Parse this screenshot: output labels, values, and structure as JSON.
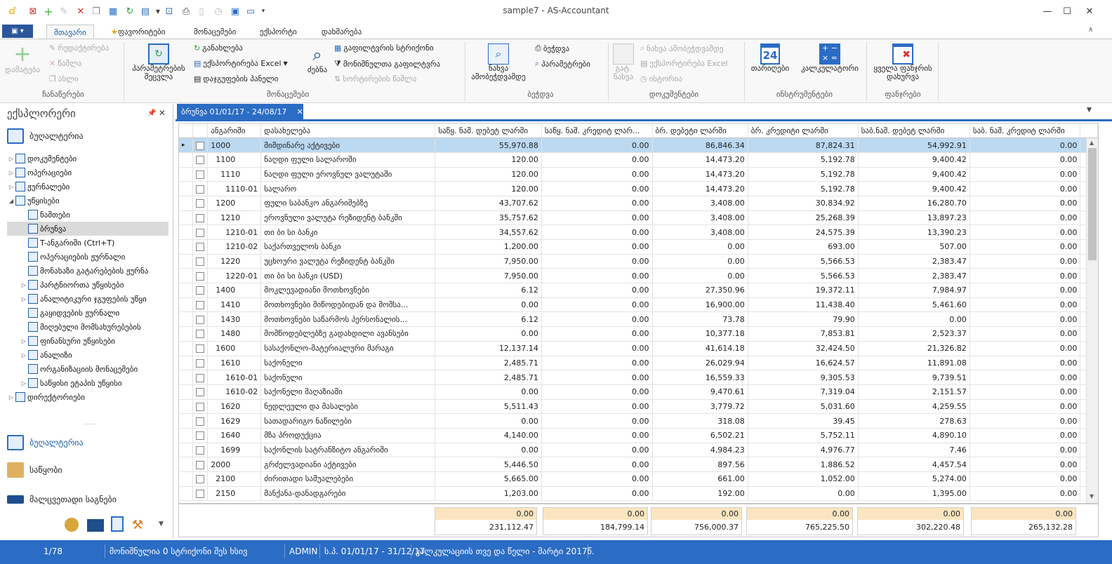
{
  "window": {
    "title": "sample7 - AS-Accountant"
  },
  "tabs": {
    "home": "მთავარი",
    "favorites": "ფავორიტები",
    "data": "მონაცემები",
    "export": "ექსპორტი",
    "help": "დახმარება"
  },
  "ribbon": {
    "add": "დამატება",
    "edit": "რედაქტირება",
    "delete": "წაშლა",
    "copy": "ასლი",
    "records_group": "ჩანაწერები",
    "change_params": "პარამეტრების შეცვლა",
    "refresh": "განახლება",
    "export_excel": "ექსპორტირება Excel",
    "group_panel": "დაჯგუფების პანელი",
    "search": "ძებნა",
    "filter_row": "გაფილტვრის სტრიქონი",
    "selected_filter": "მონიშნულთა გაფილტვრა",
    "remove_sort": "სორტირების წაშლა",
    "data_group": "მონაცემები",
    "print_preview": "ნახვა ამობეჭდვამდე",
    "print": "ბეჭდვა",
    "params": "პარამეტრები",
    "print_group": "ბეჭდვა",
    "doc_view": "გატ. ნახვა",
    "view_print": "ნახვა ამობეჭდვამდე",
    "export_excel2": "ექსპორტირება Excel",
    "history": "ისტორია",
    "documents_group": "დოკუმენტები",
    "dates": "თარიღები",
    "calculator": "კალკულატორი",
    "tools_group": "ინსტრუმენტები",
    "close_all": "ყველა ფანჯრის დახურვა",
    "windows_group": "ფანჯრები",
    "calendar_day": "24"
  },
  "explorer": {
    "title": "ექსპლორერი",
    "root": "ბუღალტერია",
    "items": [
      {
        "label": "დოკუმენტები",
        "level": 1,
        "arrow": "▷"
      },
      {
        "label": "ოპერაციები",
        "level": 1,
        "arrow": "▷"
      },
      {
        "label": "ჟურნალები",
        "level": 1,
        "arrow": "▷"
      },
      {
        "label": "უწყისები",
        "level": 1,
        "arrow": "◢"
      },
      {
        "label": "ნაშთები",
        "level": 2,
        "arrow": ""
      },
      {
        "label": "ბრუნვა",
        "level": 2,
        "arrow": "",
        "selected": true
      },
      {
        "label": "T-ანგარიში (Ctrl+T)",
        "level": 2,
        "arrow": ""
      },
      {
        "label": "ოპერაციების ჟურნალი",
        "level": 2,
        "arrow": ""
      },
      {
        "label": "მონახაზი გატარებების ჟურნა",
        "level": 2,
        "arrow": ""
      },
      {
        "label": "პარტნიორთა უწყისები",
        "level": 2,
        "arrow": "▷"
      },
      {
        "label": "ანალიტიკური ჯგუფების უწყი",
        "level": 2,
        "arrow": "▷"
      },
      {
        "label": "გაყიდვების ჟურნალი",
        "level": 2,
        "arrow": ""
      },
      {
        "label": "მიღებული მომსახურებების",
        "level": 2,
        "arrow": ""
      },
      {
        "label": "ფინანსური უწყისები",
        "level": 2,
        "arrow": "▷"
      },
      {
        "label": "ანალიზი",
        "level": 2,
        "arrow": "▷"
      },
      {
        "label": "ორგანიზაციის მონაცემები",
        "level": 2,
        "arrow": ""
      },
      {
        "label": "საწყისი ეტაპის უწყისი",
        "level": 2,
        "arrow": "▷"
      },
      {
        "label": "დირექტორიები",
        "level": 1,
        "arrow": "▷"
      }
    ],
    "bottom": {
      "accounting": "ბუღალტერია",
      "warehouse": "საწყობი",
      "low_value": "მალცვეთადი საგნები"
    }
  },
  "document_tab": {
    "label": "ბრუნვა 01/01/17 - 24/08/17",
    "close": "✕"
  },
  "grid": {
    "columns": [
      "ანგარიში",
      "დასახელება",
      "საწყ. ნაშ. დებეტ ლარში",
      "საწყ. ნაშ. კრედიტ ლარ...",
      "ბრ. დებეტი ლარში",
      "ბრ. კრედიტი ლარში",
      "საბ.ნაშ. დებეტ ლარში",
      "საბ. ნაშ. კრედიტ ლარში"
    ],
    "rows": [
      {
        "acct": "1000",
        "indent": 0,
        "name": "მიმდინარე აქტივები",
        "v": [
          "55,970.88",
          "0.00",
          "86,846.34",
          "87,824.31",
          "54,992.91",
          "0.00"
        ],
        "selected": true
      },
      {
        "acct": "1100",
        "indent": 1,
        "name": "ნაღდი ფული სალაროში",
        "v": [
          "120.00",
          "0.00",
          "14,473.20",
          "5,192.78",
          "9,400.42",
          "0.00"
        ]
      },
      {
        "acct": "1110",
        "indent": 2,
        "name": "ნაღდი ფული ეროვნულ ვალუტაში",
        "v": [
          "120.00",
          "0.00",
          "14,473.20",
          "5,192.78",
          "9,400.42",
          "0.00"
        ]
      },
      {
        "acct": "1110-01",
        "indent": 3,
        "name": "სალარო",
        "v": [
          "120.00",
          "0.00",
          "14,473.20",
          "5,192.78",
          "9,400.42",
          "0.00"
        ]
      },
      {
        "acct": "1200",
        "indent": 1,
        "name": "ფული საბანკო ანგარიშებზე",
        "v": [
          "43,707.62",
          "0.00",
          "3,408.00",
          "30,834.92",
          "16,280.70",
          "0.00"
        ]
      },
      {
        "acct": "1210",
        "indent": 2,
        "name": "ეროვნული ვალუტა რეზიდენტ ბანკში",
        "v": [
          "35,757.62",
          "0.00",
          "3,408.00",
          "25,268.39",
          "13,897.23",
          "0.00"
        ]
      },
      {
        "acct": "1210-01",
        "indent": 3,
        "name": "თი ბი სი ბანკი",
        "v": [
          "34,557.62",
          "0.00",
          "3,408.00",
          "24,575.39",
          "13,390.23",
          "0.00"
        ]
      },
      {
        "acct": "1210-02",
        "indent": 3,
        "name": "საქართველოს ბანკი",
        "v": [
          "1,200.00",
          "0.00",
          "0.00",
          "693.00",
          "507.00",
          "0.00"
        ]
      },
      {
        "acct": "1220",
        "indent": 2,
        "name": "უცხოური ვალუტა რეზიდენტ ბანკში",
        "v": [
          "7,950.00",
          "0.00",
          "0.00",
          "5,566.53",
          "2,383.47",
          "0.00"
        ]
      },
      {
        "acct": "1220-01",
        "indent": 3,
        "name": "თი ბი სი ბანკი (USD)",
        "v": [
          "7,950.00",
          "0.00",
          "0.00",
          "5,566.53",
          "2,383.47",
          "0.00"
        ]
      },
      {
        "acct": "1400",
        "indent": 1,
        "name": "მოკლევადიანი მოთხოვნები",
        "v": [
          "6.12",
          "0.00",
          "27,350.96",
          "19,372.11",
          "7,984.97",
          "0.00"
        ]
      },
      {
        "acct": "1410",
        "indent": 2,
        "name": "მოთხოვნები მიწოდებიდან და მომსა...",
        "v": [
          "0.00",
          "0.00",
          "16,900.00",
          "11,438.40",
          "5,461.60",
          "0.00"
        ]
      },
      {
        "acct": "1430",
        "indent": 2,
        "name": "მოთხოვნები საწარმოს პერსონალის...",
        "v": [
          "6.12",
          "0.00",
          "73.78",
          "79.90",
          "0.00",
          "0.00"
        ]
      },
      {
        "acct": "1480",
        "indent": 2,
        "name": "მომწოდებლებზე გადახდილი ავანსები",
        "v": [
          "0.00",
          "0.00",
          "10,377.18",
          "7,853.81",
          "2,523.37",
          "0.00"
        ]
      },
      {
        "acct": "1600",
        "indent": 1,
        "name": "სასაქონლო-მატერიალური მარაგი",
        "v": [
          "12,137.14",
          "0.00",
          "41,614.18",
          "32,424.50",
          "21,326.82",
          "0.00"
        ]
      },
      {
        "acct": "1610",
        "indent": 2,
        "name": "საქონელი",
        "v": [
          "2,485.71",
          "0.00",
          "26,029.94",
          "16,624.57",
          "11,891.08",
          "0.00"
        ]
      },
      {
        "acct": "1610-01",
        "indent": 3,
        "name": "საქონელი",
        "v": [
          "2,485.71",
          "0.00",
          "16,559.33",
          "9,305.53",
          "9,739.51",
          "0.00"
        ]
      },
      {
        "acct": "1610-02",
        "indent": 3,
        "name": "საქონელი მაღაზიაში",
        "v": [
          "0.00",
          "0.00",
          "9,470.61",
          "7,319.04",
          "2,151.57",
          "0.00"
        ]
      },
      {
        "acct": "1620",
        "indent": 2,
        "name": "ნედლეული და მასალები",
        "v": [
          "5,511.43",
          "0.00",
          "3,779.72",
          "5,031.60",
          "4,259.55",
          "0.00"
        ]
      },
      {
        "acct": "1629",
        "indent": 2,
        "name": "სათადარიგო ნაწილები",
        "v": [
          "0.00",
          "0.00",
          "318.08",
          "39.45",
          "278.63",
          "0.00"
        ]
      },
      {
        "acct": "1640",
        "indent": 2,
        "name": "მზა პროდუქცია",
        "v": [
          "4,140.00",
          "0.00",
          "6,502.21",
          "5,752.11",
          "4,890.10",
          "0.00"
        ]
      },
      {
        "acct": "1699",
        "indent": 2,
        "name": "საქონლის სატრანზიტო ანგარიში",
        "v": [
          "0.00",
          "0.00",
          "4,984.23",
          "4,976.77",
          "7.46",
          "0.00"
        ]
      },
      {
        "acct": "2000",
        "indent": 0,
        "name": "გრძელვადიანი აქტივები",
        "v": [
          "5,446.50",
          "0.00",
          "897.56",
          "1,886.52",
          "4,457.54",
          "0.00"
        ]
      },
      {
        "acct": "2100",
        "indent": 1,
        "name": "ძირითადი საშუალებები",
        "v": [
          "5,665.00",
          "0.00",
          "661.00",
          "1,052.00",
          "5,274.00",
          "0.00"
        ]
      },
      {
        "acct": "2150",
        "indent": 1,
        "name": "მანქანა-დანადგარები",
        "v": [
          "1,203.00",
          "0.00",
          "192.00",
          "0.00",
          "1,395.00",
          "0.00"
        ]
      }
    ]
  },
  "totals": {
    "zero": [
      "0.00",
      "0.00",
      "0.00",
      "0.00",
      "0.00",
      "0.00"
    ],
    "sum": [
      "231,112.47",
      "184,799.14",
      "756,000.37",
      "765,225.50",
      "302,220.48",
      "265,132.28"
    ]
  },
  "status": {
    "position": "1/78",
    "selected": "მონიშნულია 0 სტრიქონი",
    "note": "შეს ხსივ",
    "user": "ADMIN",
    "period": "ს.პ. 01/01/17 - 31/12/17",
    "calc": "კალკულაციის თვე და წელი - მარტი 2017წ."
  },
  "colors": {
    "accent": "#2b6cc4",
    "selected_row": "#bcd9f2",
    "total_bg": "#fae5c0"
  }
}
